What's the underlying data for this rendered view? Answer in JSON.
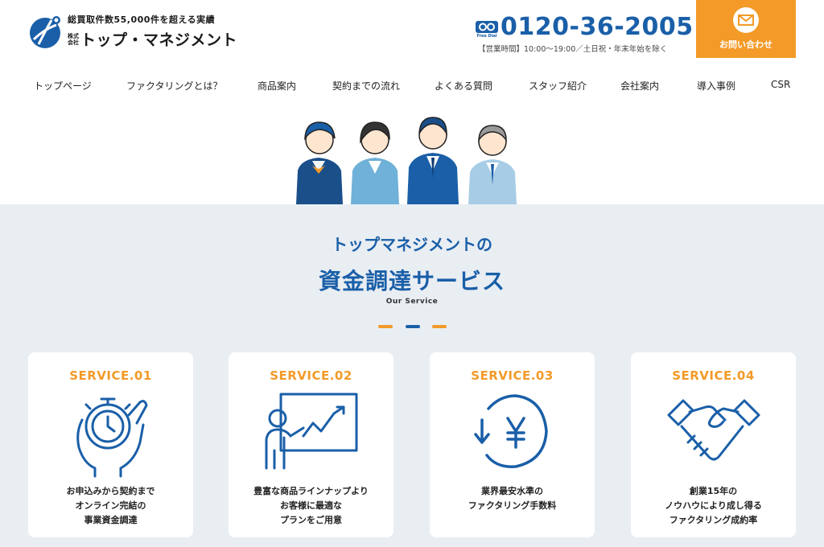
{
  "header": {
    "tagline": "総買取件数55,000件を超える実績",
    "company_prefix": "株式会社",
    "company_name": "トップ・マネジメント",
    "freedial_label": "Free Dial",
    "phone_number": "0120-36-2005",
    "business_hours": "【営業時間】10:00〜19:00／土日祝・年末年始を除く",
    "contact_label": "お問い合わせ"
  },
  "nav": {
    "items": [
      "トップページ",
      "ファクタリングとは？",
      "商品案内",
      "契約までの流れ",
      "よくある質問",
      "スタッフ紹介",
      "会社案内",
      "導入事例",
      "CSR"
    ]
  },
  "services": {
    "subtitle": "トップマネジメントの",
    "title": "資金調達サービス",
    "title_en": "Our Service",
    "cards": [
      {
        "label": "SERVICE.01",
        "icon": "stopwatch-hand-icon",
        "lines": [
          "お申込みから契約まで",
          "オンライン完結の",
          "事業資金調達"
        ]
      },
      {
        "label": "SERVICE.02",
        "icon": "presentation-chart-icon",
        "lines": [
          "豊富な商品ラインナップより",
          "お客様に最適な",
          "プランをご用意"
        ]
      },
      {
        "label": "SERVICE.03",
        "icon": "yen-down-arrow-icon",
        "lines": [
          "業界最安水準の",
          "ファクタリング手数料"
        ]
      },
      {
        "label": "SERVICE.04",
        "icon": "handshake-icon",
        "lines": [
          "創業15年の",
          "ノウハウにより成し得る",
          "ファクタリング成約率"
        ]
      }
    ]
  },
  "colors": {
    "primary_blue": "#1a5fa8",
    "accent_orange": "#f39a28",
    "section_bg": "#e9eef3"
  }
}
